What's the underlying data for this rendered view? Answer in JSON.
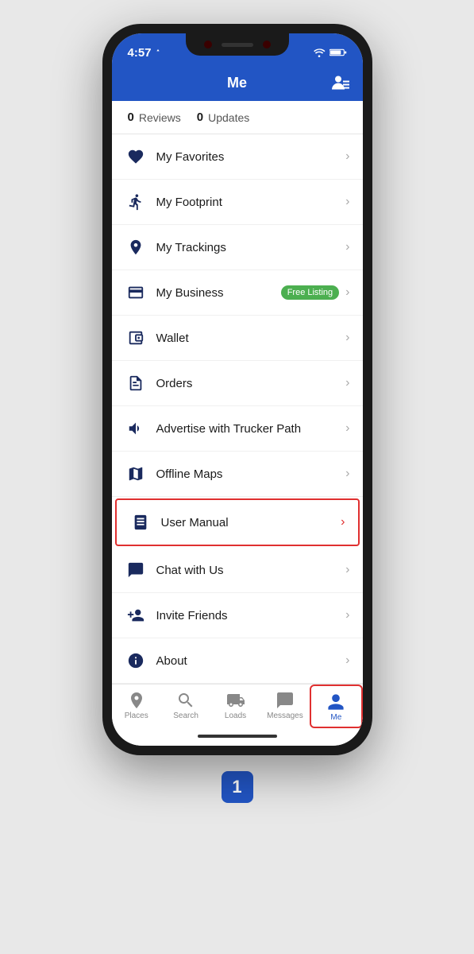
{
  "phone": {
    "status_time": "4:57",
    "header_title": "Me"
  },
  "stats": {
    "reviews_count": "0",
    "reviews_label": "Reviews",
    "updates_count": "0",
    "updates_label": "Updates"
  },
  "menu": {
    "items": [
      {
        "id": "favorites",
        "label": "My Favorites",
        "icon": "heart",
        "badge": null,
        "highlighted": false
      },
      {
        "id": "footprint",
        "label": "My Footprint",
        "icon": "footprint",
        "badge": null,
        "highlighted": false
      },
      {
        "id": "trackings",
        "label": "My Trackings",
        "icon": "tracking",
        "badge": null,
        "highlighted": false
      },
      {
        "id": "business",
        "label": "My Business",
        "icon": "business",
        "badge": "Free Listing",
        "highlighted": false
      },
      {
        "id": "wallet",
        "label": "Wallet",
        "icon": "wallet",
        "badge": null,
        "highlighted": false
      },
      {
        "id": "orders",
        "label": "Orders",
        "icon": "orders",
        "badge": null,
        "highlighted": false
      },
      {
        "id": "advertise",
        "label": "Advertise with Trucker Path",
        "icon": "advertise",
        "badge": null,
        "highlighted": false
      },
      {
        "id": "offline-maps",
        "label": "Offline Maps",
        "icon": "map",
        "badge": null,
        "highlighted": false
      },
      {
        "id": "user-manual",
        "label": "User Manual",
        "icon": "manual",
        "badge": null,
        "highlighted": true
      },
      {
        "id": "chat",
        "label": "Chat with Us",
        "icon": "chat",
        "badge": null,
        "highlighted": false
      },
      {
        "id": "invite",
        "label": "Invite Friends",
        "icon": "invite",
        "badge": null,
        "highlighted": false
      },
      {
        "id": "about",
        "label": "About",
        "icon": "about",
        "badge": null,
        "highlighted": false
      }
    ]
  },
  "bottom_nav": {
    "items": [
      {
        "id": "places",
        "label": "Places",
        "active": false
      },
      {
        "id": "search",
        "label": "Search",
        "active": false
      },
      {
        "id": "loads",
        "label": "Loads",
        "active": false
      },
      {
        "id": "messages",
        "label": "Messages",
        "active": false
      },
      {
        "id": "me",
        "label": "Me",
        "active": true
      }
    ]
  },
  "page_number": "1"
}
